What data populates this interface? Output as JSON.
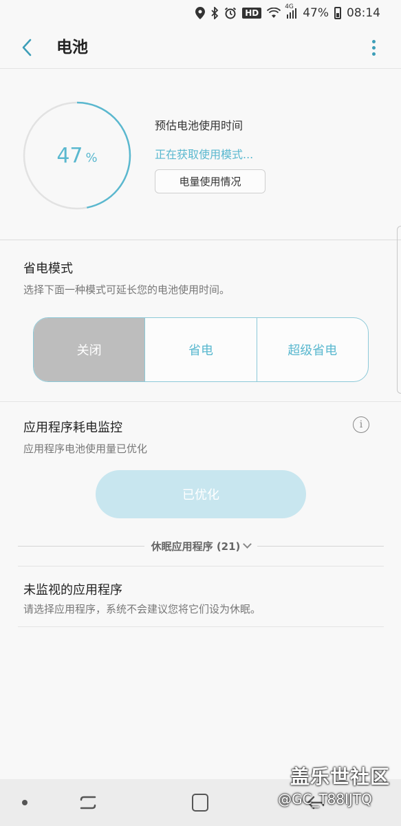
{
  "status_bar": {
    "hd": "HD",
    "network": "4G",
    "battery": "47%",
    "time": "08:14",
    "icons": [
      "location-icon",
      "bluetooth-icon",
      "alarm-icon",
      "wifi-icon",
      "signal-icon",
      "battery-icon"
    ]
  },
  "header": {
    "title": "电池",
    "back_icon": "back-chevron-icon",
    "more_icon": "more-vert-icon"
  },
  "summary": {
    "percent": "47",
    "percent_symbol": "%",
    "level": 0.47,
    "estimate_label": "预估电池使用时间",
    "estimate_status": "正在获取使用模式...",
    "usage_button": "电量使用情况"
  },
  "power_saving": {
    "title": "省电模式",
    "subtitle": "选择下面一种模式可延长您的电池使用时间。",
    "modes": [
      "关闭",
      "省电",
      "超级省电"
    ],
    "selected_index": 0
  },
  "app_monitor": {
    "title": "应用程序耗电监控",
    "subtitle": "应用程序电池使用量已优化",
    "button": "已优化",
    "info_icon": "i",
    "sleeping_apps": "休眠应用程序 (21)"
  },
  "unmonitored": {
    "title": "未监视的应用程序",
    "subtitle": "请选择应用程序，系统不会建议您将它们设为休眠。"
  },
  "watermark": {
    "title": "盖乐世社区",
    "handle": "@GC_T88IJTQ"
  },
  "colors": {
    "accent": "#5ab8cf",
    "ring_track": "#e2e2e2",
    "selected_mode": "#bdbdbd",
    "optimized_button": "#c8e6ef"
  }
}
